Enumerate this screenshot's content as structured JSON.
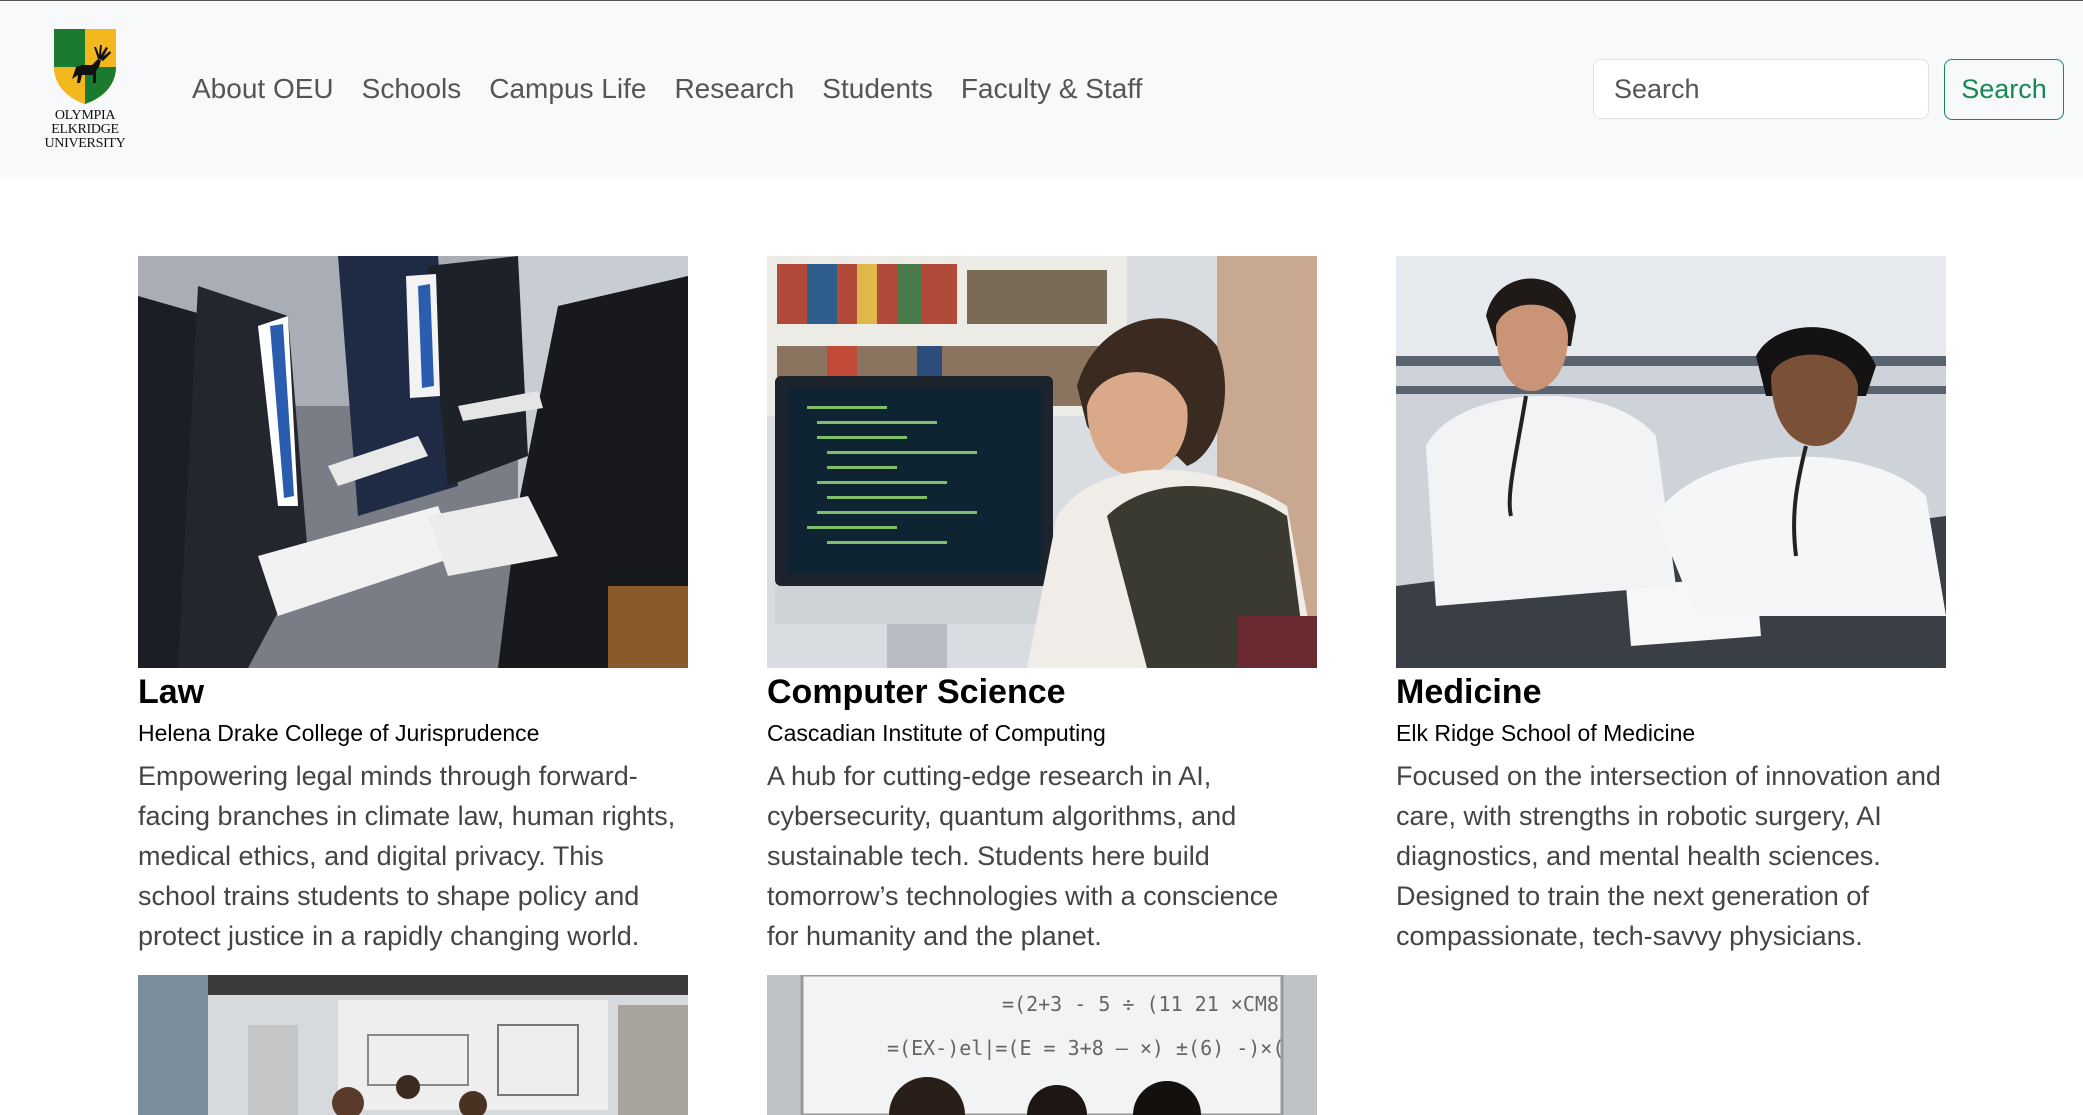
{
  "header": {
    "logo_lines": [
      "OLYMPIA",
      "ELKRIDGE",
      "UNIVERSITY"
    ],
    "nav": [
      "About OEU",
      "Schools",
      "Campus Life",
      "Research",
      "Students",
      "Faculty & Staff"
    ],
    "search": {
      "placeholder": "Search",
      "button_label": "Search"
    }
  },
  "colors": {
    "shield_green": "#1a7a2e",
    "shield_gold": "#f2b81e",
    "accent_green": "#198754"
  },
  "schools": [
    {
      "title": "Law",
      "subtitle": "Helena Drake College of Jurisprudence",
      "description": "Empowering legal minds through forward-facing branches in climate law, human rights, medical ethics, and digital privacy. This school trains students to shape policy and protect justice in a rapidly changing world."
    },
    {
      "title": "Computer Science",
      "subtitle": "Cascadian Institute of Computing",
      "description": "A hub for cutting-edge research in AI, cybersecurity, quantum algorithms, and sustainable tech. Students here build tomorrow’s technologies with a conscience for humanity and the planet."
    },
    {
      "title": "Medicine",
      "subtitle": "Elk Ridge School of Medicine",
      "description": "Focused on the intersection of innovation and care, with strengths in robotic surgery, AI diagnostics, and mental health sciences. Designed to train the next generation of compassionate, tech-savvy physicians."
    }
  ],
  "whiteboard_text": [
    "=(2+3 - 5 ÷ (11 21 ×CM8",
    "=(EX-)el|=(E = 3+8 — ×) ±(6) -)×("
  ]
}
